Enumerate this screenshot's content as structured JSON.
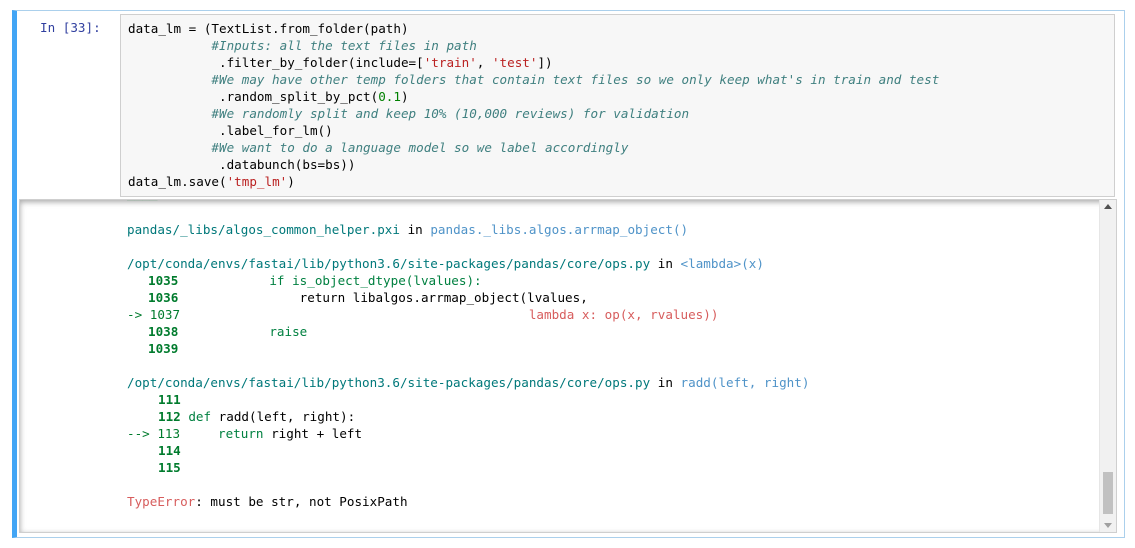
{
  "cell": {
    "prompt": "In [33]:"
  },
  "code": {
    "lines": [
      "data_lm = (TextList.from_folder(path)",
      "           #Inputs: all the text files in path",
      "            .filter_by_folder(include=['train', 'test'])",
      "           #We may have other temp folders that contain text files so we only keep what's in train and test",
      "            .random_split_by_pct(0.1)",
      "           #We randomly split and keep 10% (10,000 reviews) for validation",
      "            .label_for_lm()",
      "           #We want to do a language model so we label accordingly",
      "            .databunch(bs=bs))",
      "data_lm.save('tmp_lm')"
    ]
  },
  "traceback": {
    "frame1_file": "pandas/_libs/algos_common_helper.pxi",
    "frame1_in": "in",
    "frame1_func": "pandas._libs.algos.arrmap_object()",
    "frame2_file": "/opt/conda/envs/fastai/lib/python3.6/site-packages/pandas/core/ops.py",
    "frame2_in": "in",
    "frame2_func": "<lambda>(x)",
    "frame2_lines": {
      "l1035_num": "1035",
      "l1035_code": "            if is_object_dtype(lvalues):",
      "l1036_num": "1036",
      "l1036_code": "                return libalgos.arrmap_object(lvalues,",
      "l1037_arrow": "-> 1037",
      "l1037_code": "                                              lambda x: op(x, rvalues))",
      "l1038_num": "1038",
      "l1038_code": "            raise",
      "l1039_num": "1039"
    },
    "frame3_file": "/opt/conda/envs/fastai/lib/python3.6/site-packages/pandas/core/ops.py",
    "frame3_in": "in",
    "frame3_func": "radd(left, right)",
    "frame3_lines": {
      "l111_num": "111",
      "l112_num": "112",
      "l112_kw": "def",
      "l112_code": " radd(left, right):",
      "l113_arrow": "--> 113",
      "l113_kw": "return",
      "l113_code": " right + left",
      "l114_num": "114",
      "l115_num": "115"
    },
    "error_type": "TypeError",
    "error_msg": ": must be str, not PosixPath"
  }
}
